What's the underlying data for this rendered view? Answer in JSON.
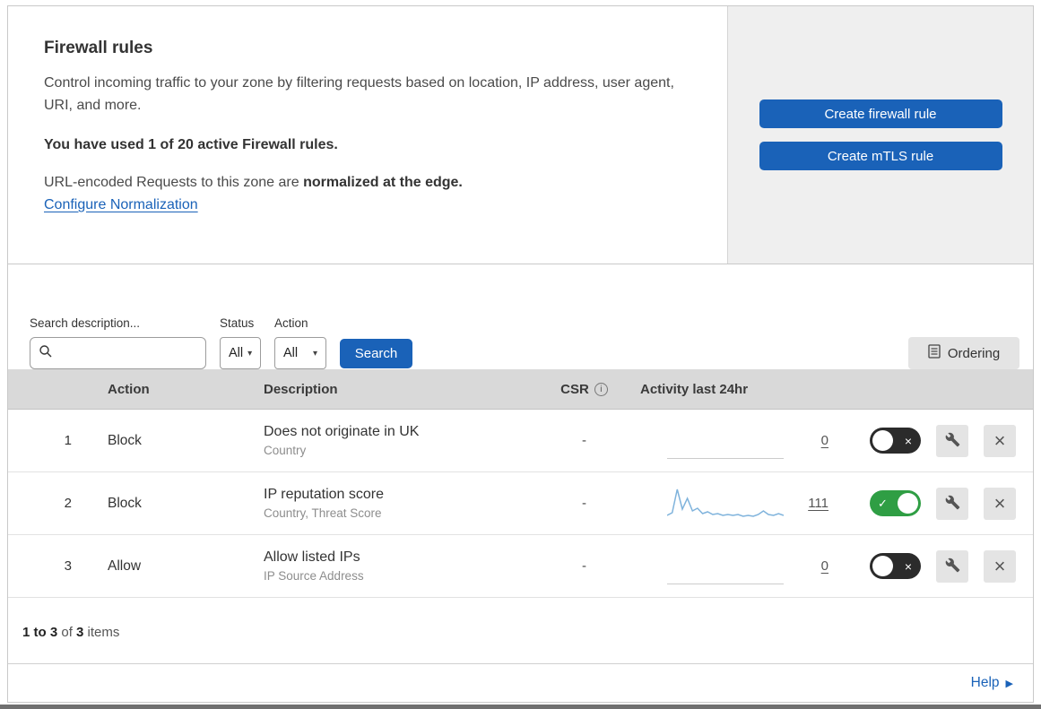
{
  "colors": {
    "accent_blue": "#1a62b8",
    "link_blue": "#1a62b8",
    "toggle_green": "#2f9e44",
    "toggle_off_bg": "#2b2b2b",
    "sparkline": "#7fb3dc",
    "header_row_gray": "#d9d9d9",
    "panel_gray": "#efefef",
    "control_button_gray": "#e4e4e4"
  },
  "header": {
    "title": "Firewall rules",
    "description": "Control incoming traffic to your zone by filtering requests based on location, IP address, user agent, URI, and more.",
    "usage_note": "You have used 1 of 20 active Firewall rules.",
    "normalization_text": "URL-encoded Requests to this zone are ",
    "normalization_bold": "normalized at the edge.",
    "normalization_link": "Configure Normalization",
    "create_firewall_button": "Create firewall rule",
    "create_mtls_button": "Create mTLS rule"
  },
  "filters": {
    "search_label": "Search description...",
    "status_label": "Status",
    "status_value": "All",
    "action_label": "Action",
    "action_value": "All",
    "search_button": "Search",
    "ordering_button": "Ordering"
  },
  "table": {
    "headers": {
      "action": "Action",
      "description": "Description",
      "csr": "CSR",
      "activity": "Activity last 24hr"
    },
    "rows": [
      {
        "priority": "1",
        "action": "Block",
        "title": "Does not originate in UK",
        "subtitle": "Country",
        "csr": "-",
        "activity_count": "0",
        "enabled": false
      },
      {
        "priority": "2",
        "action": "Block",
        "title": "IP reputation score",
        "subtitle": "Country, Threat Score",
        "csr": "-",
        "activity_count": "111",
        "enabled": true,
        "sparkline": [
          5,
          8,
          34,
          12,
          24,
          10,
          13,
          7,
          9,
          6,
          7,
          5,
          6,
          5,
          6,
          4,
          5,
          4,
          6,
          10,
          6,
          5,
          7,
          5
        ]
      },
      {
        "priority": "3",
        "action": "Allow",
        "title": "Allow listed IPs",
        "subtitle": "IP Source Address",
        "csr": "-",
        "activity_count": "0",
        "enabled": false
      }
    ]
  },
  "footer": {
    "range": "1 to 3",
    "of_text": " of ",
    "total": "3",
    "items_text": " items"
  },
  "help": {
    "label": "Help"
  },
  "icons": {
    "info": "i",
    "dropdown_caret": "▾",
    "toggle_check": "✓",
    "toggle_cross": "×",
    "close": "×",
    "help_arrow": "▶"
  }
}
